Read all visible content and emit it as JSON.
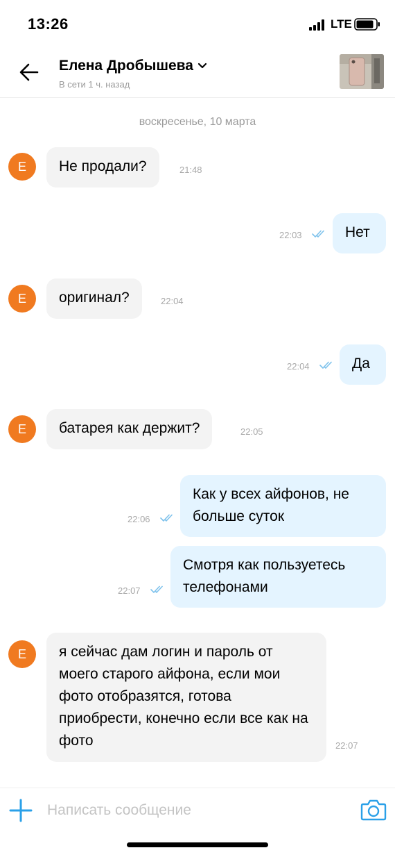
{
  "status_bar": {
    "time": "13:26",
    "network": "LTE",
    "icons": [
      "signal-bars-icon",
      "battery-icon"
    ]
  },
  "header": {
    "contact_name": "Елена Дробышева",
    "contact_status": "В сети 1 ч. назад",
    "icons": [
      "back-arrow-icon",
      "chevron-down-icon"
    ]
  },
  "chat": {
    "date_separator": "воскресенье, 10 марта",
    "avatar_letter": "Е",
    "messages": [
      {
        "direction": "in",
        "text": "Не продали?",
        "time": "21:48"
      },
      {
        "direction": "out",
        "text": "Нет",
        "time": "22:03",
        "read": true
      },
      {
        "direction": "in",
        "text": "оригинал?",
        "time": "22:04"
      },
      {
        "direction": "out",
        "text": "Да",
        "time": "22:04",
        "read": true
      },
      {
        "direction": "in",
        "text": "батарея как держит?",
        "time": "22:05"
      },
      {
        "direction": "out",
        "text": "Как у всех айфонов, не больше суток",
        "time": "22:06",
        "read": true
      },
      {
        "direction": "out",
        "text": "Смотря как пользуетесь телефонами",
        "time": "22:07",
        "read": true
      },
      {
        "direction": "in",
        "text": "я сейчас дам логин и пароль от моего старого айфона, если мои фото отобразятся, готова приобрести, конечно если все как на фото",
        "time": "22:07"
      }
    ]
  },
  "composer": {
    "placeholder": "Написать сообщение",
    "value": "",
    "icons": [
      "plus-icon",
      "camera-icon"
    ]
  },
  "colors": {
    "accent": "#2aa0e8",
    "avatar": "#f07a20",
    "incoming_bubble": "#f3f3f3",
    "outgoing_bubble": "#e4f4ff",
    "muted_text": "#9b9b9b"
  }
}
